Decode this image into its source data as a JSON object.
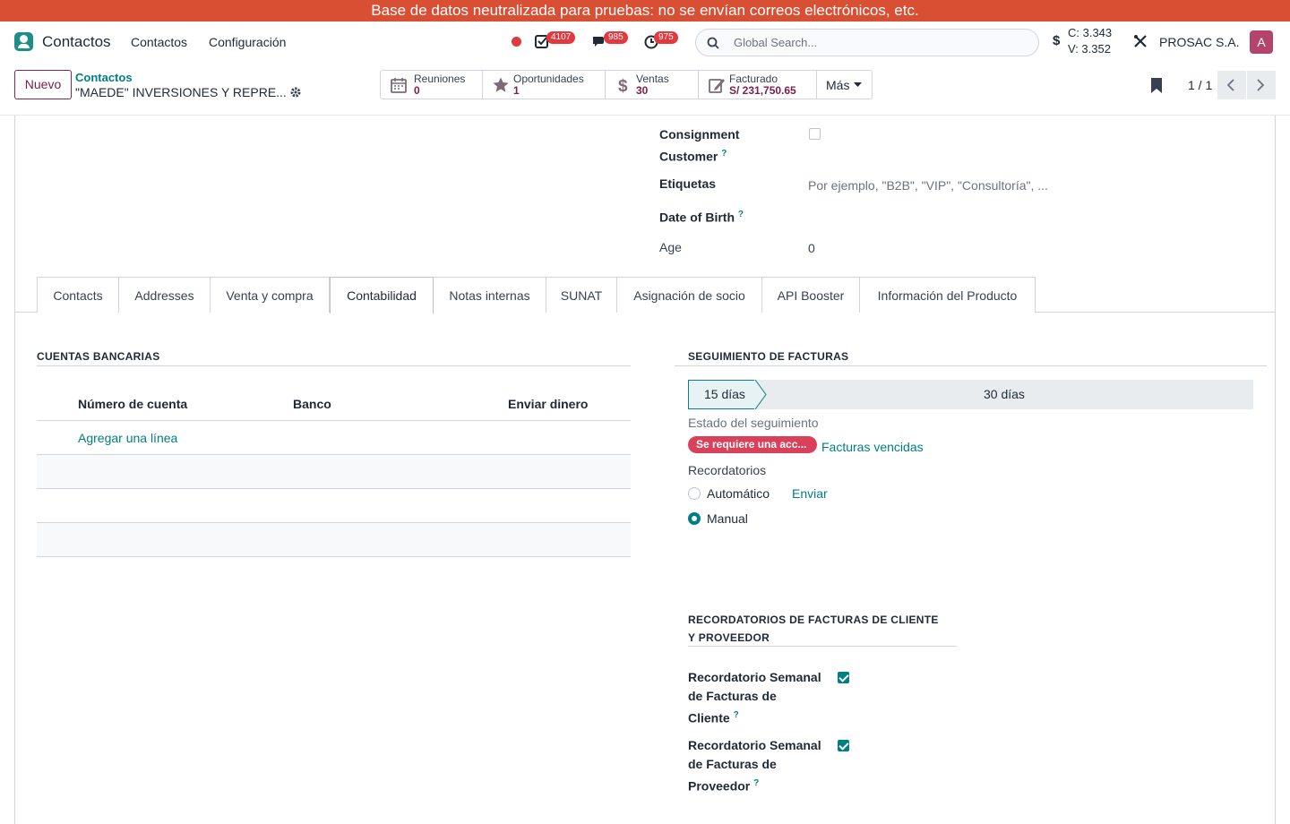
{
  "banner": {
    "text": "Base de datos neutralizada para pruebas: no se envían correos electrónicos, etc."
  },
  "navbar": {
    "app_name": "Contactos",
    "menus": [
      "Contactos",
      "Configuración"
    ],
    "badges": {
      "activities": "4107",
      "messages": "985",
      "clock": "975"
    },
    "search_placeholder": "Global Search...",
    "currency_symbol": "$",
    "rate_c": "C: 3.343",
    "rate_v": "V: 3.352",
    "company": "PROSAC S.A.",
    "avatar_initial": "A"
  },
  "control_panel": {
    "new_button": "Nuevo",
    "breadcrumb_parent": "Contactos",
    "breadcrumb_current": "\"MAEDE\" INVERSIONES Y REPRE...",
    "smart_buttons": [
      {
        "label": "Reuniones",
        "value": "0",
        "icon": "calendar-icon"
      },
      {
        "label": "Oportunidades",
        "value": "1",
        "icon": "star-icon"
      },
      {
        "label": "Ventas",
        "value": "30",
        "icon": "dollar-icon"
      },
      {
        "label": "Facturado",
        "value": "S/ 231,750.65",
        "icon": "invoice-icon"
      }
    ],
    "more_label": "Más",
    "pager": "1 / 1"
  },
  "fields": {
    "consignment_label_1": "Consignment",
    "consignment_label_2": "Customer",
    "consignment_checked": false,
    "tags_label": "Etiquetas",
    "tags_placeholder": "Por ejemplo, \"B2B\", \"VIP\", \"Consultoría\", ...",
    "dob_label": "Date of Birth",
    "age_label": "Age",
    "age_value": "0",
    "help_mark": "?"
  },
  "tabs": [
    "Contacts",
    "Addresses",
    "Venta y compra",
    "Contabilidad",
    "Notas internas",
    "SUNAT",
    "Asignación de socio",
    "API Booster",
    "Información del Producto"
  ],
  "active_tab": "Contabilidad",
  "bank": {
    "title": "CUENTAS BANCARIAS",
    "columns": [
      "Número de cuenta",
      "Banco",
      "Enviar dinero"
    ],
    "add_line": "Agregar una línea"
  },
  "followup": {
    "title": "SEGUIMIENTO DE FACTURAS",
    "steps": [
      "15 días",
      "30 días"
    ],
    "active_step": "15 días",
    "status_label": "Estado del seguimiento",
    "status_badge": "Se requiere una acc...",
    "overdue_link": "Facturas vencidas",
    "reminders_label": "Recordatorios",
    "options": [
      "Automático",
      "Manual"
    ],
    "selected_option": "Manual",
    "send_link": "Enviar"
  },
  "reminders": {
    "title_line1": "RECORDATORIOS DE FACTURAS DE CLIENTE",
    "title_line2": "Y PROVEEDOR",
    "customer": {
      "l1": "Recordatorio Semanal",
      "l2": "de Facturas de",
      "l3": "Cliente",
      "checked": true
    },
    "vendor": {
      "l1": "Recordatorio Semanal",
      "l2": "de Facturas de",
      "l3": "Proveedor",
      "checked": true
    }
  },
  "colors": {
    "banner": "#d94f34",
    "brand": "#7b1e48",
    "teal": "#017e84",
    "danger": "#d9405a"
  }
}
